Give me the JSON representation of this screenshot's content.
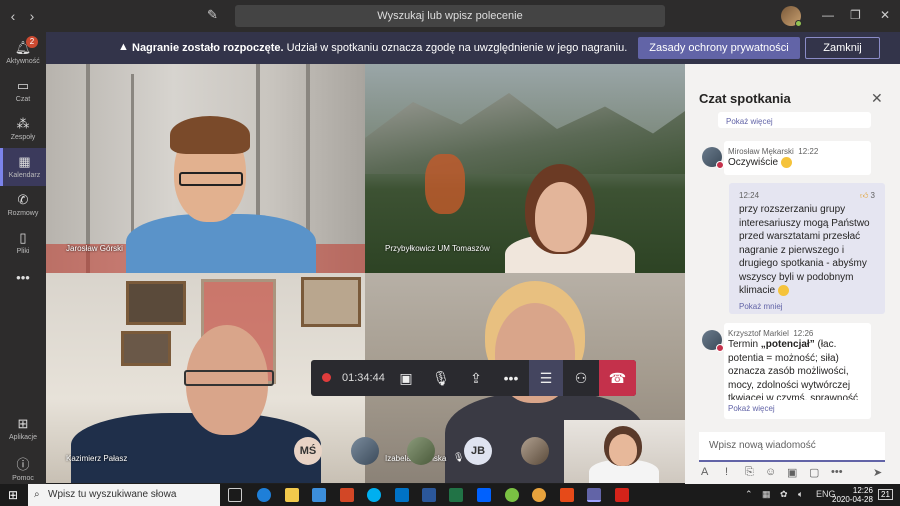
{
  "titlebar": {
    "search_placeholder": "Wyszukaj lub wpisz polecenie"
  },
  "rail": {
    "items": [
      {
        "label": "Aktywność",
        "badge": "2",
        "icon": "bell-icon"
      },
      {
        "label": "Czat",
        "icon": "chat-icon"
      },
      {
        "label": "Zespoły",
        "icon": "teams-icon"
      },
      {
        "label": "Kalendarz",
        "icon": "calendar-icon"
      },
      {
        "label": "Rozmowy",
        "icon": "phone-icon"
      },
      {
        "label": "Pliki",
        "icon": "files-icon"
      },
      {
        "label": "Aplikacje",
        "icon": "apps-icon"
      },
      {
        "label": "Pomoc",
        "icon": "help-icon"
      }
    ]
  },
  "banner": {
    "bold": "Nagranie zostało rozpoczęte.",
    "text": "Udział w spotkaniu oznacza zgodę na uwzględnienie w jego nagraniu.",
    "privacy_button": "Zasady ochrony prywatności",
    "close_button": "Zamknij"
  },
  "participants": [
    {
      "name": "Jarosław Górski"
    },
    {
      "name": "Przybyłkowicz UM Tomaszów"
    },
    {
      "name": "Kazimierz Pałasz"
    },
    {
      "name": "Izabela Śliwińska"
    }
  ],
  "call_toolbar": {
    "timer": "01:34:44"
  },
  "mini_avatars": [
    "MŚ",
    "JB"
  ],
  "chat": {
    "title": "Czat spotkania",
    "more_top": "Pokaż więcej",
    "messages": [
      {
        "author": "Mirosław Mękarski",
        "time": "12:22",
        "text": "Oczywiście"
      },
      {
        "time": "12:24",
        "likes": "3",
        "text": "przy rozszerzaniu grupy interesariuszy mogą Państwo przed warsztatami przesłać nagranie z pierwszego i drugiego spotkania - abyśmy wszyscy byli w podobnym klimacie",
        "less": "Pokaż mniej"
      },
      {
        "author": "Krzysztof Markiel",
        "time": "12:26",
        "text_bold": "„potencjał”",
        "text_pre": "Termin ",
        "text": "(łac. potentia = możność; siła) oznacza zasób możliwości, mocy, zdolności wytwórczej tkwiącej w czymś, sprawność",
        "more": "Pokaż więcej"
      }
    ],
    "input_placeholder": "Wpisz nową wiadomość"
  },
  "taskbar": {
    "search_placeholder": "Wpisz tu wyszukiwane słowa",
    "time": "12:26",
    "date": "2020-04-28",
    "notification_count": "21"
  }
}
